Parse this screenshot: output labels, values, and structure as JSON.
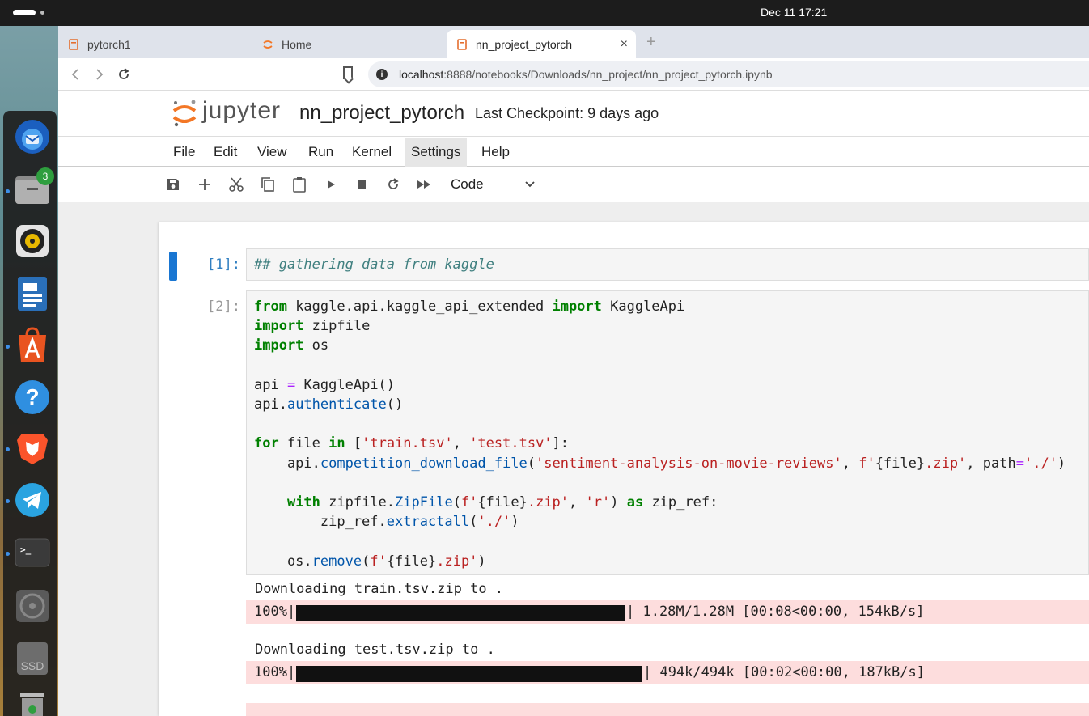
{
  "system": {
    "clock": "Dec 11  17:21"
  },
  "dock": {
    "badge_count": "3",
    "items": [
      "thunderbird-icon",
      "files-icon",
      "rhythmbox-icon",
      "writer-icon",
      "app-center-icon",
      "help-icon",
      "brave-icon",
      "telegram-icon",
      "terminal-icon",
      "disc-icon",
      "ssd-icon",
      "trash-icon"
    ],
    "terminal_glyph": ">_",
    "help_glyph": "?",
    "ssd_label": "SSD"
  },
  "browser": {
    "tabs": [
      {
        "label": "pytorch1"
      },
      {
        "label": "Home"
      },
      {
        "label": "nn_project_pytorch"
      }
    ],
    "new_tab": "+",
    "tab_close": "×",
    "url_host": "localhost",
    "url_rest": ":8888/notebooks/Downloads/nn_project/nn_project_pytorch.ipynb"
  },
  "jupyter": {
    "logo_text": "jupyter",
    "notebook_name": "nn_project_pytorch",
    "checkpoint": "Last Checkpoint: 9 days ago",
    "menu": [
      "File",
      "Edit",
      "View",
      "Run",
      "Kernel",
      "Settings",
      "Help"
    ],
    "cell_type": "Code"
  },
  "cells": {
    "c1": {
      "prompt": "[1]:",
      "text": "## gathering data from kaggle"
    },
    "c2": {
      "prompt": "[2]:",
      "outputs": {
        "l1": "Downloading train.tsv.zip to .",
        "p1_pct": "100%|",
        "p1_rest": "| 1.28M/1.28M [00:08<00:00, 154kB/s]",
        "p1_fill": 1.0,
        "l2": "Downloading test.tsv.zip to .",
        "p2_pct": "100%|",
        "p2_rest": "| 494k/494k [00:02<00:00, 187kB/s]",
        "p2_fill": 1.0
      }
    }
  }
}
